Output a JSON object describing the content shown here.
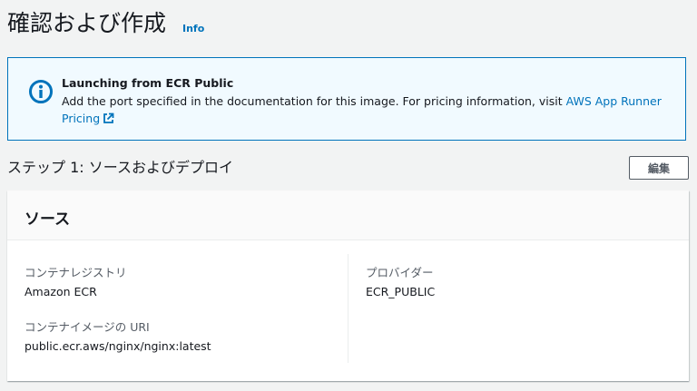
{
  "page": {
    "title": "確認および作成",
    "info_link": "Info"
  },
  "alert": {
    "icon": "info-circle-icon",
    "title": "Launching from ECR Public",
    "body_text": "Add the port specified in the documentation for this image. For pricing information, visit ",
    "link_text": "AWS App Runner Pricing",
    "accent_color": "#0073bb"
  },
  "step": {
    "title": "ステップ 1: ソースおよびデプロイ",
    "edit_label": "編集"
  },
  "source_card": {
    "title": "ソース",
    "left": {
      "registry_label": "コンテナレジストリ",
      "registry_value": "Amazon ECR",
      "uri_label": "コンテナイメージの URI",
      "uri_value": "public.ecr.aws/nginx/nginx:latest"
    },
    "right": {
      "provider_label": "プロバイダー",
      "provider_value": "ECR_PUBLIC"
    }
  }
}
